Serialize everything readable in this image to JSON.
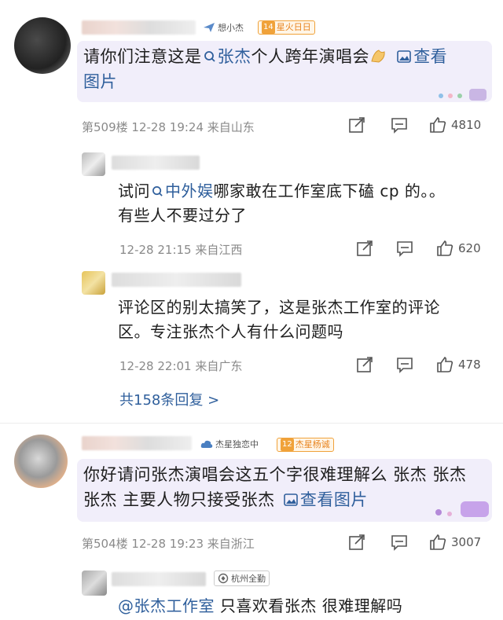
{
  "comments": [
    {
      "fan_badge": "想小杰",
      "level_num": "14",
      "level_label": "星火日日",
      "text_a": "请你们注意这是",
      "topic_link": "张杰",
      "text_b": "个人跨年演唱会",
      "image_link": "查看",
      "text_c": "图片",
      "floor": "第509楼",
      "time": "12-28 19:24",
      "location": "来自山东",
      "likes": "4810"
    },
    {
      "fan_badge": "杰星独恋中",
      "level_num": "12",
      "level_label": "杰星杨诚",
      "text_a": "你好请问张杰演唱会这五个字很难理解么 张杰 张杰",
      "text_b": "张杰 主要人物只接受张杰",
      "image_link": "查看图片",
      "floor": "第504楼",
      "time": "12-28 19:23",
      "location": "来自浙江",
      "likes": "3007"
    }
  ],
  "replies": [
    {
      "text_a": "试问",
      "topic_link": "中外娱",
      "text_b": "哪家敢在工作室底下磕 cp 的。。",
      "text_c": "有些人不要过分了",
      "time": "12-28 21:15",
      "location": "来自江西",
      "likes": "620"
    },
    {
      "text_a": "评论区的别太搞笑了，这是张杰工作室的评论",
      "text_b": "区。专注张杰个人有什么问题吗",
      "time": "12-28 22:01",
      "location": "来自广东",
      "likes": "478"
    }
  ],
  "more_replies": "共158条回复 >",
  "last_reply": {
    "badge": "杭州全勤",
    "mention": "@张杰工作室",
    "text": "只喜欢看张杰 很难理解吗"
  },
  "colors": {
    "link": "#2f5f9c",
    "bubble": "#f1eefa",
    "meta": "#8a8a8a",
    "level": "#f0a23a"
  },
  "icons": [
    "share-icon",
    "comment-icon",
    "like-icon",
    "search-icon",
    "image-icon",
    "plane-icon",
    "hand-emoji-icon"
  ]
}
